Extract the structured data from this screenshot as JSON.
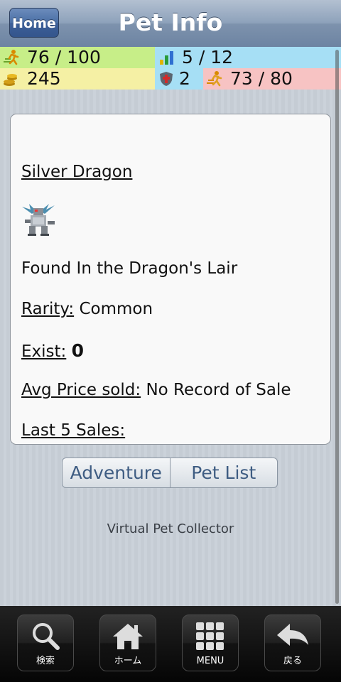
{
  "header": {
    "home_label": "Home",
    "title": "Pet Info"
  },
  "stats": {
    "energy": "76 / 100",
    "level": "5 / 12",
    "gold": "245",
    "defense": "2",
    "stamina": "73 / 80"
  },
  "pet": {
    "name": "Silver Dragon",
    "location": "Found In the Dragon's Lair",
    "rarity_label": "Rarity:",
    "rarity_value": "Common",
    "exist_label": "Exist:",
    "exist_value": "0",
    "avg_price_label": "Avg Price sold:",
    "avg_price_value": "No Record of Sale",
    "last_sales_label": "Last 5 Sales:"
  },
  "actions": {
    "adventure": "Adventure",
    "pet_list": "Pet List"
  },
  "footer": {
    "text": "Virtual Pet Collector"
  },
  "tabbar": {
    "search": "検索",
    "home": "ホーム",
    "menu": "MENU",
    "back": "戻る"
  }
}
